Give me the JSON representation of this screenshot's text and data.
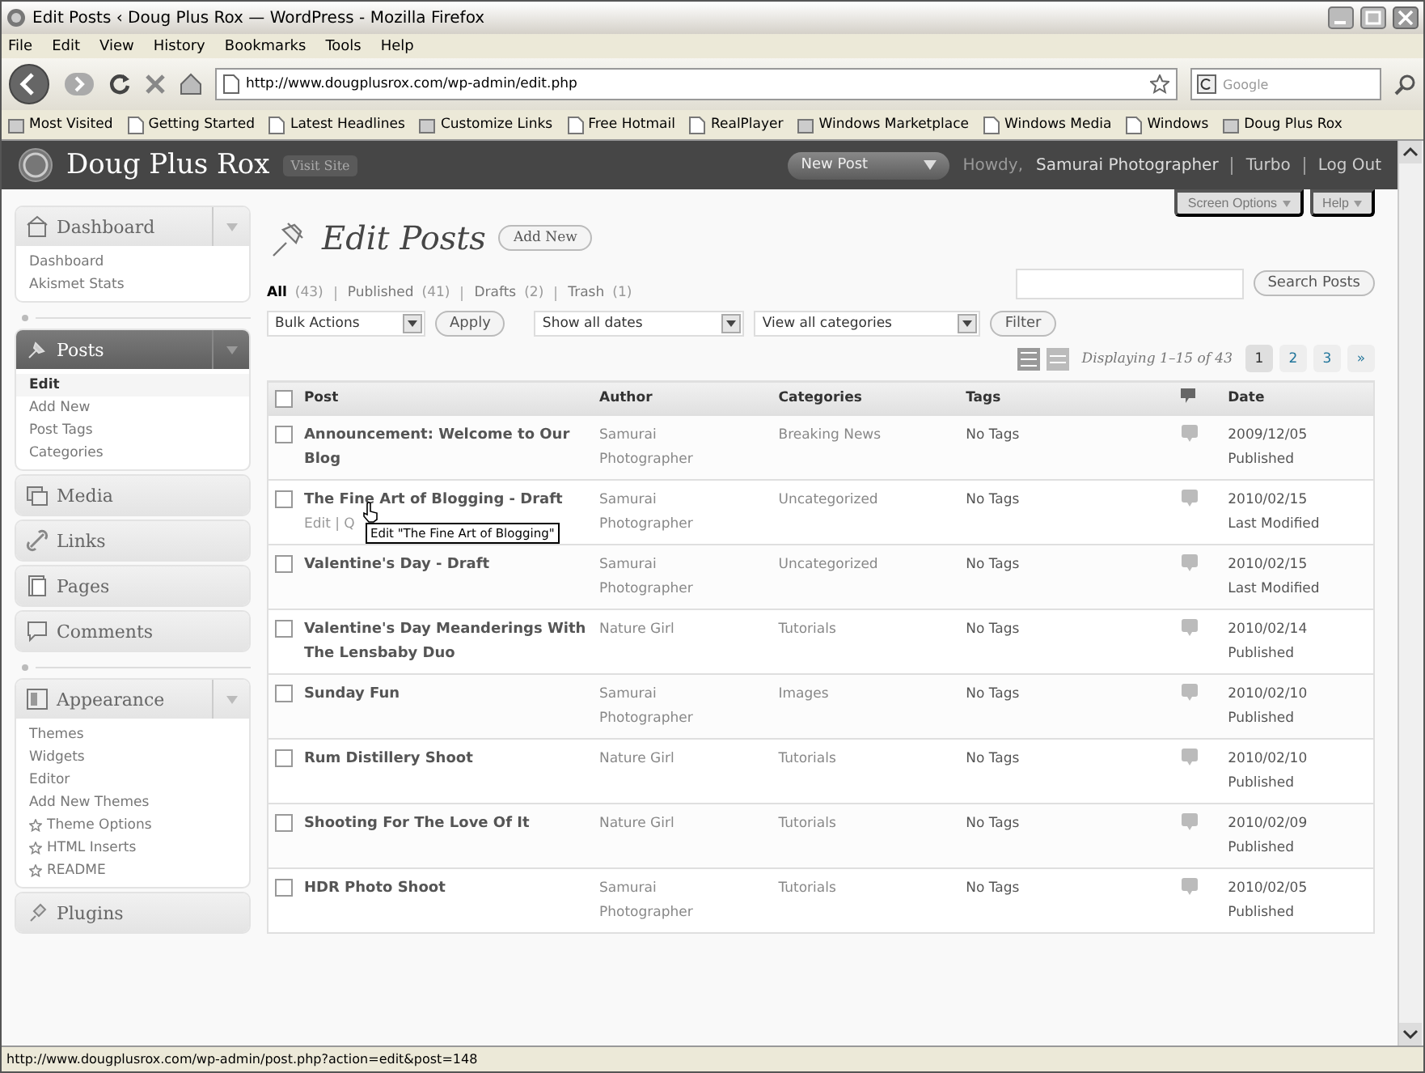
{
  "browser": {
    "title": "Edit Posts ‹ Doug Plus Rox — WordPress - Mozilla Firefox",
    "menu": [
      "File",
      "Edit",
      "View",
      "History",
      "Bookmarks",
      "Tools",
      "Help"
    ],
    "url": "http://www.dougplusrox.com/wp-admin/edit.php",
    "search": {
      "placeholder": "Google"
    },
    "bookmarks": [
      "Most Visited",
      "Getting Started",
      "Latest Headlines",
      "Customize Links",
      "Free Hotmail",
      "RealPlayer",
      "Windows Marketplace",
      "Windows Media",
      "Windows",
      "Doug Plus Rox"
    ],
    "status_bar": "http://www.dougplusrox.com/wp-admin/post.php?action=edit&post=148"
  },
  "header": {
    "site": "Doug Plus Rox",
    "visit": "Visit Site",
    "new_post": "New Post",
    "greeting": "Howdy,",
    "user": "Samurai Photographer",
    "links": [
      "Turbo",
      "Log Out"
    ]
  },
  "screen_tabs": [
    "Screen Options",
    "Help"
  ],
  "sidebar": {
    "menus": [
      {
        "label": "Dashboard",
        "current": false,
        "expanded": true,
        "children": [
          {
            "label": "Dashboard",
            "selected": false
          },
          {
            "label": "Akismet Stats",
            "selected": false
          }
        ]
      },
      {
        "kind": "separator"
      },
      {
        "label": "Posts",
        "current": true,
        "expanded": true,
        "children": [
          {
            "label": "Edit",
            "selected": true
          },
          {
            "label": "Add New",
            "selected": false
          },
          {
            "label": "Post Tags",
            "selected": false
          },
          {
            "label": "Categories",
            "selected": false
          }
        ]
      },
      {
        "label": "Media",
        "current": false,
        "expanded": false
      },
      {
        "label": "Links",
        "current": false,
        "expanded": false
      },
      {
        "label": "Pages",
        "current": false,
        "expanded": false
      },
      {
        "label": "Comments",
        "current": false,
        "expanded": false
      },
      {
        "kind": "separator"
      },
      {
        "label": "Appearance",
        "current": false,
        "expanded": true,
        "children": [
          {
            "label": "Themes",
            "selected": false
          },
          {
            "label": "Widgets",
            "selected": false
          },
          {
            "label": "Editor",
            "selected": false
          },
          {
            "label": "Add New Themes",
            "selected": false
          },
          {
            "label": "Theme Options",
            "selected": false,
            "kind": "plugin"
          },
          {
            "label": "HTML Inserts",
            "selected": false,
            "kind": "plugin"
          },
          {
            "label": "README",
            "selected": false,
            "kind": "plugin"
          }
        ]
      },
      {
        "label": "Plugins",
        "current": false,
        "expanded": false
      }
    ]
  },
  "page": {
    "title": "Edit Posts",
    "add_new": "Add New",
    "filters": [
      {
        "label": "All",
        "count": "(43)",
        "selected": true
      },
      {
        "label": "Published",
        "count": "(41)",
        "selected": false
      },
      {
        "label": "Drafts",
        "count": "(2)",
        "selected": false
      },
      {
        "label": "Trash",
        "count": "(1)",
        "selected": false
      }
    ],
    "search_button": "Search Posts",
    "bulk_actions": "Bulk Actions",
    "apply": "Apply",
    "dates": "Show all dates",
    "categories": "View all categories",
    "filter": "Filter",
    "displaying": "Displaying 1–15 of 43",
    "pages": [
      {
        "label": "1",
        "selected": true
      },
      {
        "label": "2",
        "selected": false
      },
      {
        "label": "3",
        "selected": false
      },
      {
        "label": "»",
        "selected": false
      }
    ]
  },
  "table": {
    "columns": [
      "Post",
      "Author",
      "Categories",
      "Tags",
      "Date"
    ],
    "header_checked": false,
    "rows": [
      {
        "title": "Announcement: Welcome to Our Blog",
        "state": "",
        "author": "Samurai Photographer",
        "category": "Breaking News",
        "tags": "No Tags",
        "date": "2009/12/05",
        "status": "Published",
        "checked": false
      },
      {
        "title": "The Fine Art of Blogging",
        "state": "- Draft",
        "author": "Samurai Photographer",
        "category": "Uncategorized",
        "tags": "No Tags",
        "date": "2010/02/15",
        "status": "Last Modified",
        "checked": false,
        "row_actions": "Edit | Q",
        "tooltip": "Edit \"The Fine Art of Blogging\""
      },
      {
        "title": "Valentine's Day",
        "state": "- Draft",
        "author": "Samurai Photographer",
        "category": "Uncategorized",
        "tags": "No Tags",
        "date": "2010/02/15",
        "status": "Last Modified",
        "checked": false
      },
      {
        "title": "Valentine's Day Meanderings With The Lensbaby Duo",
        "state": "",
        "author": "Nature Girl",
        "category": "Tutorials",
        "tags": "No Tags",
        "date": "2010/02/14",
        "status": "Published",
        "checked": false
      },
      {
        "title": "Sunday Fun",
        "state": "",
        "author": "Samurai Photographer",
        "category": "Images",
        "tags": "No Tags",
        "date": "2010/02/10",
        "status": "Published",
        "checked": false
      },
      {
        "title": "Rum Distillery Shoot",
        "state": "",
        "author": "Nature Girl",
        "category": "Tutorials",
        "tags": "No Tags",
        "date": "2010/02/10",
        "status": "Published",
        "checked": false
      },
      {
        "title": "Shooting For The Love Of It",
        "state": "",
        "author": "Nature Girl",
        "category": "Tutorials",
        "tags": "No Tags",
        "date": "2010/02/09",
        "status": "Published",
        "checked": false
      },
      {
        "title": "HDR Photo Shoot",
        "state": "",
        "author": "Samurai Photographer",
        "category": "Tutorials",
        "tags": "No Tags",
        "date": "2010/02/05",
        "status": "Published",
        "checked": false
      }
    ]
  }
}
